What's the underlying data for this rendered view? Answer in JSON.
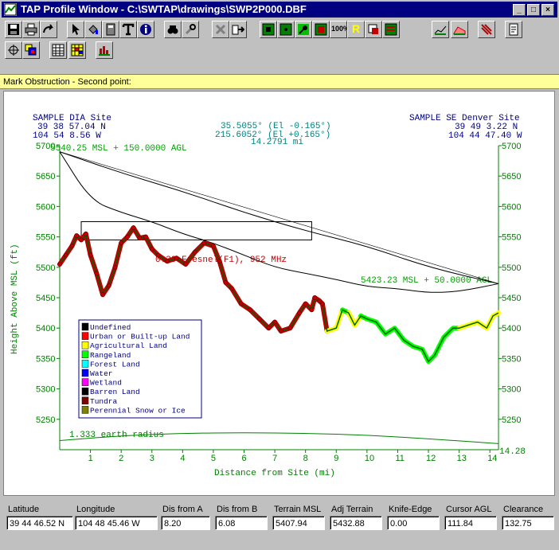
{
  "window": {
    "title": "TAP Profile Window - C:\\SWTAP\\drawings\\SWP2P000.DBF",
    "min_label": "_",
    "max_label": "□",
    "close_label": "×"
  },
  "toolbar": {
    "row1": [
      "save-icon",
      "print-icon",
      "redo-icon",
      "pointer-icon",
      "paint-bucket-icon",
      "calculator-icon",
      "text-icon",
      "info-icon",
      "binoculars-icon",
      "wrench-icon",
      "cross-icon",
      "exit-icon",
      "grid-icon",
      "dot-icon",
      "pin-icon",
      "red-square-icon",
      "zoom-100-icon",
      "letter-r-icon",
      "record-icon",
      "map-icon",
      "terrain-icon",
      "terrain-fill-icon",
      "hatched-icon",
      "page-icon"
    ],
    "row2": [
      "crosshair-icon",
      "color-palette-icon",
      "table-icon",
      "color-table-icon",
      "bar-chart-icon"
    ],
    "zoom_label": "100%",
    "r_label": "R"
  },
  "status_text": "Mark Obstruction - Second point:",
  "plot": {
    "site_a": {
      "name": "SAMPLE DIA Site",
      "lat": "39 38 57.04 N",
      "lon": "104 54  8.56 W"
    },
    "site_b": {
      "name": "SAMPLE SE Denver Site",
      "lat": "39 49  3.22 N",
      "lon": "104 44 47.40 W"
    },
    "azimuth_a": "35.5055° (El -0.165°)",
    "azimuth_b": "215.6052° (El +0.165°)",
    "distance": "14.2791 mi",
    "antenna_a": "5540.25 MSL + 150.0000 AGL",
    "antenna_b": "5423.23 MSL + 50.0000 AGL",
    "fresnel_label": "0.30 Fresnel(F1), 952 MHz",
    "earth_label": "1.333 earth radius",
    "curvature_value": "14.28",
    "y_axis_label": "Height Above MSL (ft)",
    "x_axis_label": "Distance from Site (mi)",
    "y_ticks": [
      "5700",
      "5650",
      "5600",
      "5550",
      "5500",
      "5450",
      "5400",
      "5350",
      "5300",
      "5250"
    ],
    "x_ticks": [
      "1",
      "2",
      "3",
      "4",
      "5",
      "6",
      "7",
      "8",
      "9",
      "10",
      "11",
      "12",
      "13",
      "14"
    ],
    "legend": [
      {
        "label": "Undefined",
        "color": "#000000"
      },
      {
        "label": "Urban or Built-up Land",
        "color": "#ff0000"
      },
      {
        "label": "Agricultural Land",
        "color": "#ffff00"
      },
      {
        "label": "Rangeland",
        "color": "#00ff00"
      },
      {
        "label": "Forest Land",
        "color": "#00ffff"
      },
      {
        "label": "Water",
        "color": "#0000ff"
      },
      {
        "label": "Wetland",
        "color": "#ff00ff"
      },
      {
        "label": "Barren Land",
        "color": "#000000"
      },
      {
        "label": "Tundra",
        "color": "#800000"
      },
      {
        "label": "Perennial Snow or Ice",
        "color": "#808000"
      }
    ]
  },
  "chart_data": {
    "type": "line",
    "xlabel": "Distance from Site (mi)",
    "ylabel": "Height Above MSL (ft)",
    "xlim": [
      0,
      14.28
    ],
    "ylim": [
      5200,
      5700
    ],
    "terrain": {
      "x": [
        0,
        0.2,
        0.4,
        0.55,
        0.7,
        0.85,
        1.0,
        1.2,
        1.4,
        1.6,
        1.8,
        2.0,
        2.2,
        2.4,
        2.6,
        2.8,
        3.0,
        3.2,
        3.5,
        3.8,
        4.1,
        4.4,
        4.7,
        5.0,
        5.2,
        5.4,
        5.6,
        5.9,
        6.2,
        6.5,
        6.8,
        7.0,
        7.2,
        7.5,
        7.8,
        8.0,
        8.2,
        8.3,
        8.45,
        8.55,
        8.7,
        9.0,
        9.2,
        9.4,
        9.6,
        9.8,
        10.0,
        10.3,
        10.6,
        10.9,
        11.2,
        11.5,
        11.8,
        12.0,
        12.2,
        12.5,
        12.8,
        13.0,
        13.3,
        13.6,
        13.9,
        14.1,
        14.28
      ],
      "y": [
        5505,
        5520,
        5535,
        5552,
        5545,
        5555,
        5520,
        5490,
        5455,
        5470,
        5500,
        5540,
        5550,
        5565,
        5548,
        5550,
        5530,
        5520,
        5510,
        5515,
        5505,
        5525,
        5540,
        5535,
        5510,
        5475,
        5465,
        5440,
        5430,
        5415,
        5400,
        5410,
        5395,
        5400,
        5425,
        5440,
        5430,
        5450,
        5445,
        5440,
        5395,
        5400,
        5430,
        5425,
        5405,
        5420,
        5415,
        5410,
        5390,
        5400,
        5380,
        5370,
        5365,
        5345,
        5355,
        5385,
        5400,
        5400,
        5405,
        5410,
        5400,
        5420,
        5425
      ]
    },
    "los_line": {
      "x": [
        0,
        14.28
      ],
      "y": [
        5690,
        5473
      ]
    },
    "fresnel_upper": {
      "x": [
        0,
        2,
        4,
        6,
        8,
        10,
        12,
        14.28
      ],
      "y": [
        5690,
        5655,
        5625,
        5590,
        5560,
        5535,
        5500,
        5473
      ]
    },
    "fresnel_lower": {
      "x": [
        0,
        1,
        2,
        3,
        4,
        5,
        6,
        7,
        8,
        9,
        10,
        11,
        12,
        13,
        14.28
      ],
      "y": [
        5690,
        5610,
        5590,
        5575,
        5555,
        5540,
        5520,
        5500,
        5490,
        5480,
        5468,
        5465,
        5458,
        5460,
        5473
      ]
    },
    "obstruction_box": {
      "x": [
        0.7,
        8.2
      ],
      "y": [
        5545,
        5575
      ]
    },
    "earth_curve": {
      "x": [
        0,
        2,
        4,
        6,
        8,
        10,
        12,
        14.28
      ],
      "y": [
        5215,
        5223,
        5227,
        5228,
        5227,
        5224,
        5218,
        5210
      ]
    }
  },
  "fields": [
    {
      "label": "Latitude",
      "value": "39 44 46.52 N"
    },
    {
      "label": "Longitude",
      "value": "104 48 45.46 W"
    },
    {
      "label": "Dis from A",
      "value": "8.20"
    },
    {
      "label": "Dis from B",
      "value": "6.08"
    },
    {
      "label": "Terrain MSL",
      "value": "5407.94"
    },
    {
      "label": "Adj Terrain",
      "value": "5432.88"
    },
    {
      "label": "Knife-Edge",
      "value": "0.00"
    },
    {
      "label": "Cursor AGL",
      "value": "111.84"
    },
    {
      "label": "Clearance",
      "value": "132.75"
    }
  ],
  "colors": {
    "title_bg": "#000080",
    "status_bg": "#ffff99",
    "axis_green": "#008000",
    "text_blue": "#000080",
    "text_teal": "#008080",
    "fresnel_red": "#c00000"
  }
}
